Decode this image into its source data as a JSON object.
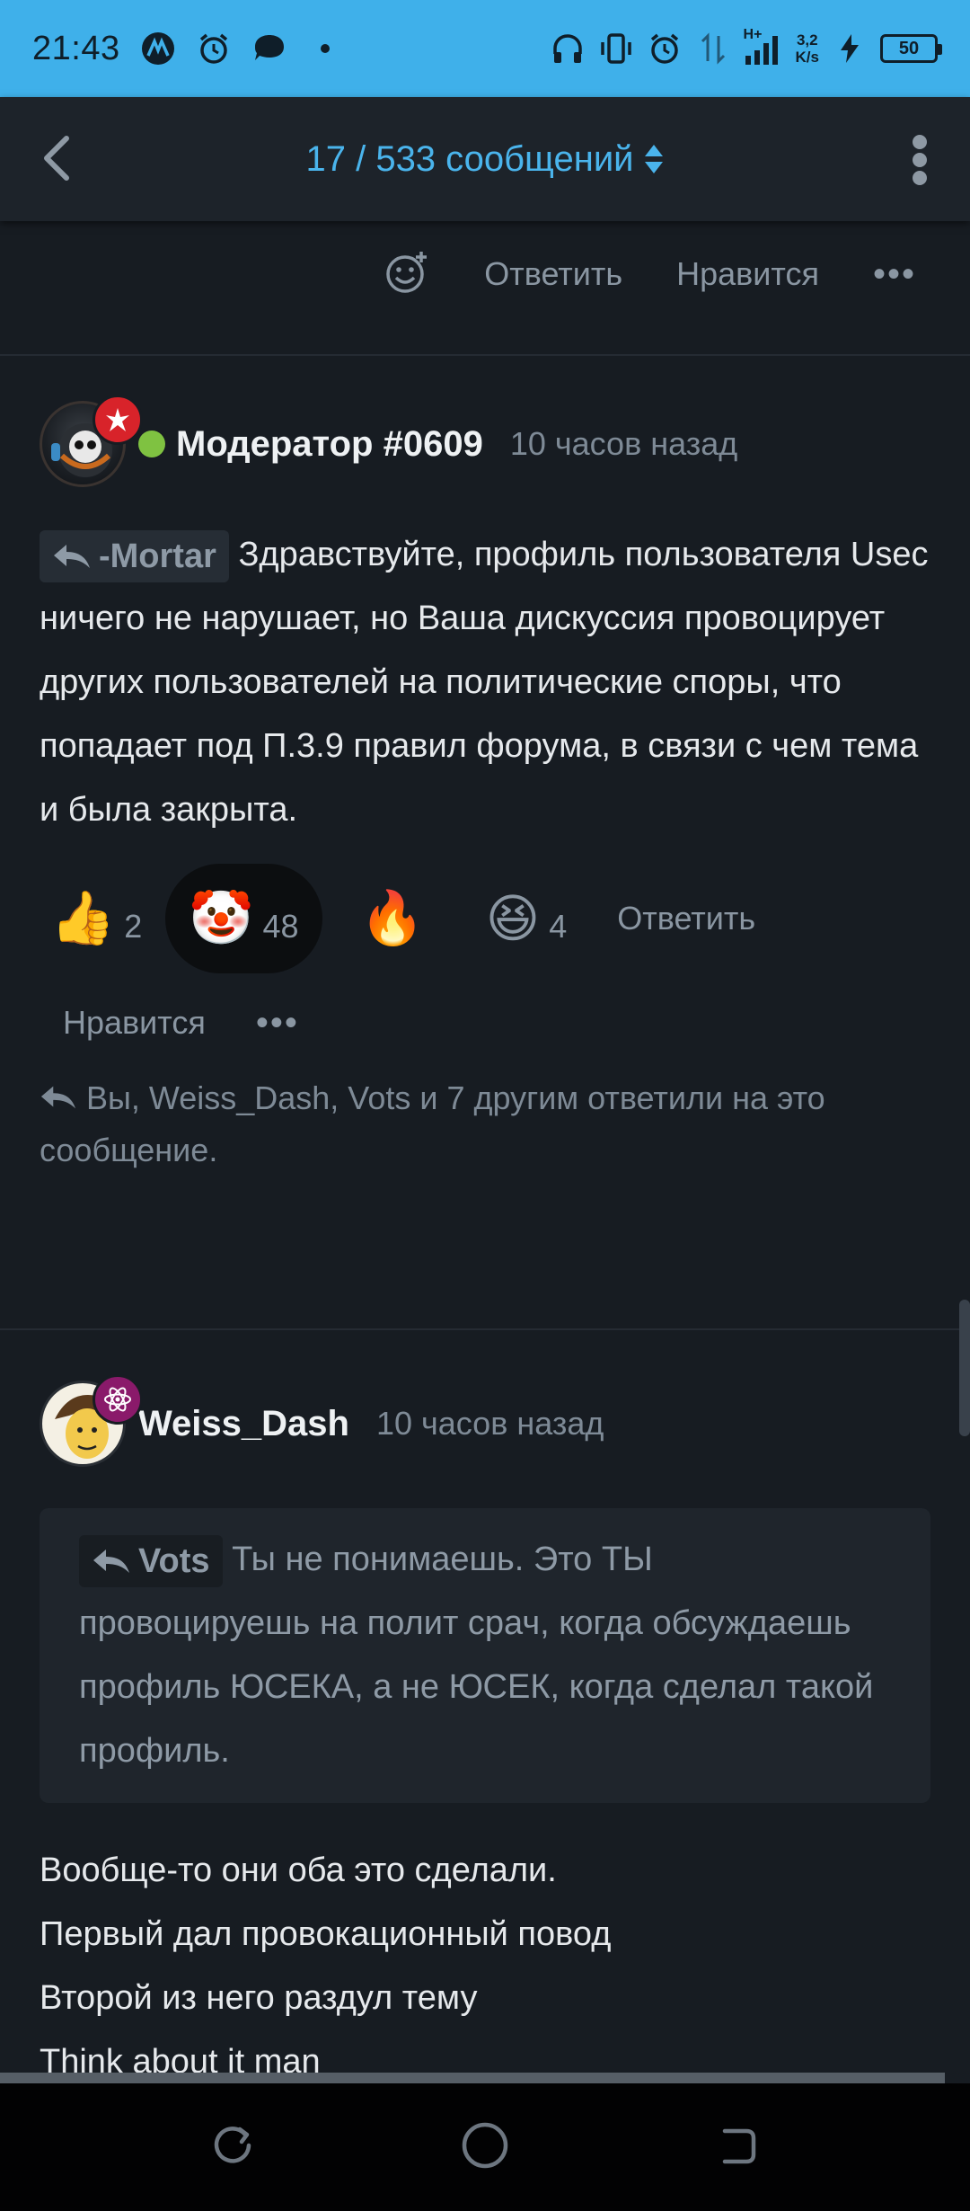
{
  "status_bar": {
    "time": "21:43",
    "speed_value": "3,2",
    "speed_unit": "K/s",
    "network": "H+",
    "battery": "50"
  },
  "top_bar": {
    "counter": "17 / 533 сообщений"
  },
  "prev_post": {
    "reply_label": "Ответить",
    "like_label": "Нравится"
  },
  "post1": {
    "author": "Модератор #0609",
    "time": "10 часов назад",
    "mention": "-Mortar",
    "text": "Здравствуйте, профиль пользователя Usec ничего не нарушает, но Ваша дискуссия провоцирует других пользователей на политические споры, что попадает под П.3.9 правил форума, в связи с чем тема и была закрыта.",
    "reactions": [
      {
        "emoji": "👍",
        "count": "2"
      },
      {
        "emoji": "🤡",
        "count": "48"
      },
      {
        "emoji": "🔥",
        "count": ""
      },
      {
        "emoji": "😆",
        "count": "4"
      }
    ],
    "reply_label": "Ответить",
    "like_label": "Нравится",
    "replies_note": "Вы, Weiss_Dash, Vots и 7 другим ответили на это сообщение."
  },
  "post2": {
    "author": "Weiss_Dash",
    "time": "10 часов назад",
    "quote_author": "Vots",
    "quote_text": "Ты не понимаешь. Это ТЫ провоцируешь на полит срач, когда обсуждаешь профиль ЮСЕКА, а не ЮСЕК, когда сделал такой профиль.",
    "lines": [
      "Вообще-то они оба это сделали.",
      "Первый дал провокационный повод",
      "Второй из него раздул тему",
      "Think about it man"
    ]
  },
  "colors": {
    "status_bar": "#3fb0ea",
    "accent": "#4ab4ec",
    "background": "#171c22",
    "online": "#7fc241",
    "mod_badge": "#d8232a",
    "user_badge": "#8a1a6a"
  }
}
